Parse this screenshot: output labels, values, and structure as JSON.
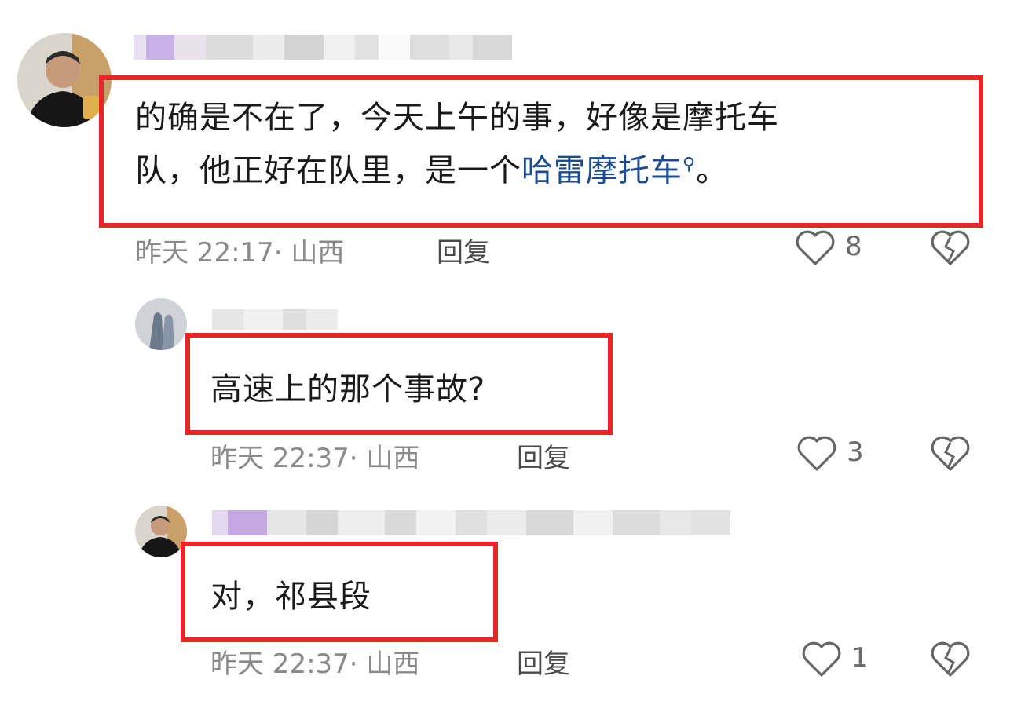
{
  "comments": [
    {
      "text_parts": [
        "的确是不在了，今天上午的事，好像是摩托车",
        "队，他正好在队里，是一个"
      ],
      "link": "哈雷摩托车",
      "link_after": "。",
      "time": "昨天 22:17· 山西",
      "reply": "回复",
      "likes": "8"
    },
    {
      "text": "高速上的那个事故?",
      "time": "昨天 22:37· 山西",
      "reply": "回复",
      "likes": "3"
    },
    {
      "text": "对，祁县段",
      "time": "昨天 22:37· 山西",
      "reply": "回复",
      "likes": "1"
    }
  ],
  "colors": {
    "highlight_box": "#e8262a",
    "link": "#1d4b8f",
    "meta": "#8a8a8a"
  }
}
